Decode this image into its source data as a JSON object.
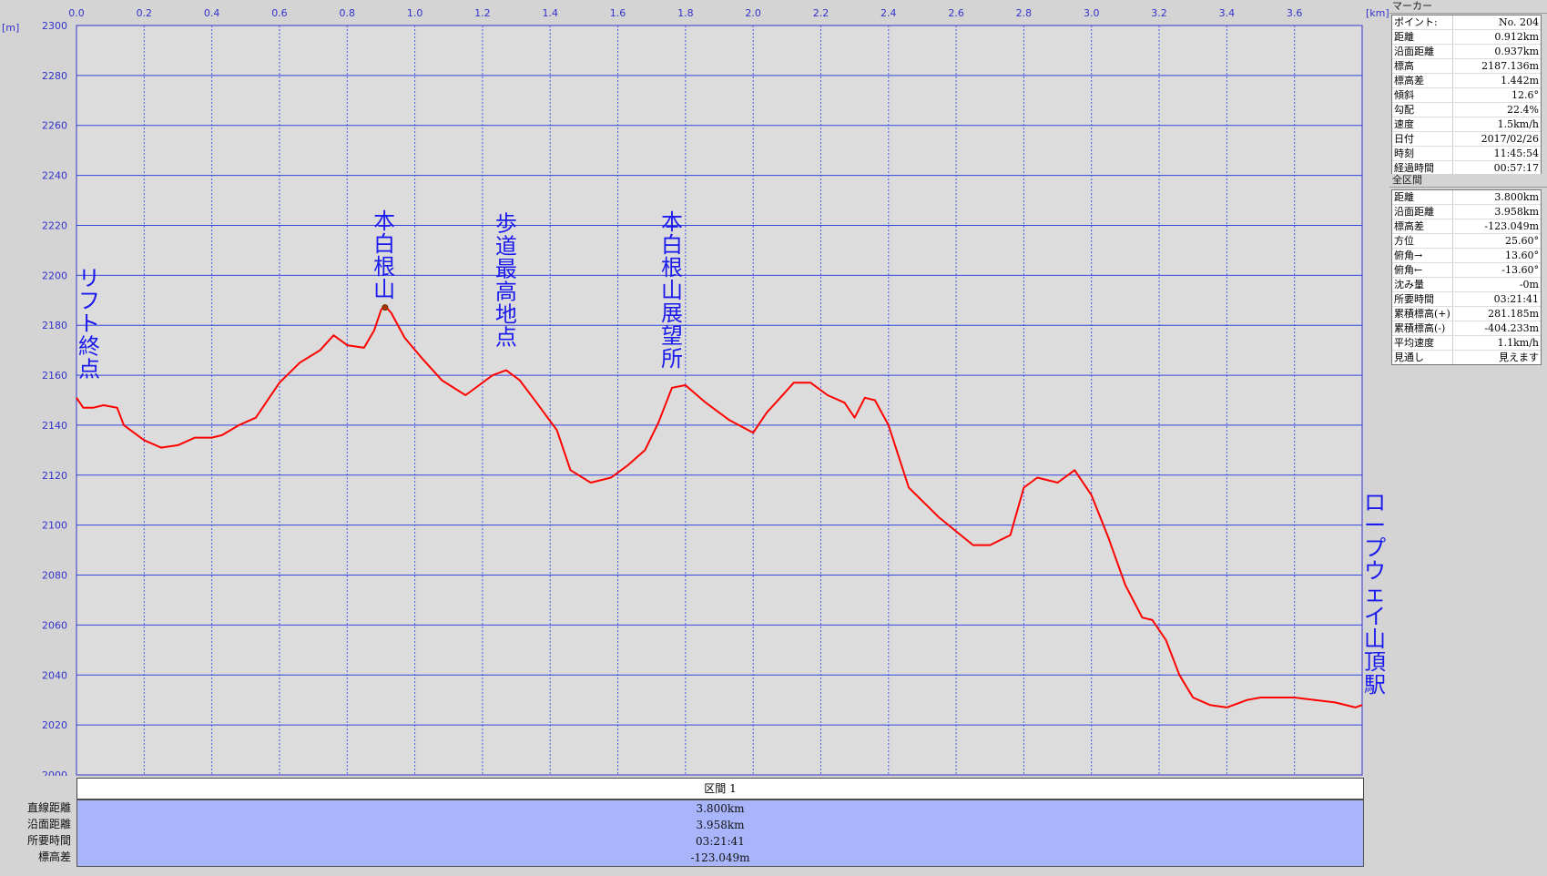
{
  "chart_data": {
    "type": "line",
    "xunit": "[km]",
    "yunit": "[m]",
    "xlim": [
      0,
      3.8
    ],
    "ylim": [
      2000,
      2300
    ],
    "xticks": [
      "0.0",
      "0.2",
      "0.4",
      "0.6",
      "0.8",
      "1.0",
      "1.2",
      "1.4",
      "1.6",
      "1.8",
      "2.0",
      "2.2",
      "2.4",
      "2.6",
      "2.8",
      "3.0",
      "3.2",
      "3.4",
      "3.6"
    ],
    "yticks": [
      "2000",
      "2020",
      "2040",
      "2060",
      "2080",
      "2100",
      "2120",
      "2140",
      "2160",
      "2180",
      "2200",
      "2220",
      "2240",
      "2260",
      "2280",
      "2300"
    ],
    "grid": true,
    "series": [
      {
        "color": "#ff0000",
        "x": [
          0.0,
          0.02,
          0.05,
          0.08,
          0.12,
          0.14,
          0.2,
          0.25,
          0.3,
          0.35,
          0.4,
          0.43,
          0.48,
          0.53,
          0.6,
          0.66,
          0.72,
          0.76,
          0.8,
          0.85,
          0.88,
          0.9,
          0.91,
          0.93,
          0.97,
          1.02,
          1.08,
          1.15,
          1.23,
          1.27,
          1.31,
          1.36,
          1.42,
          1.46,
          1.52,
          1.58,
          1.63,
          1.68,
          1.72,
          1.76,
          1.8,
          1.86,
          1.93,
          2.0,
          2.04,
          2.08,
          2.12,
          2.17,
          2.22,
          2.27,
          2.3,
          2.33,
          2.36,
          2.4,
          2.46,
          2.55,
          2.65,
          2.7,
          2.76,
          2.8,
          2.84,
          2.9,
          2.95,
          3.0,
          3.05,
          3.1,
          3.15,
          3.18,
          3.22,
          3.26,
          3.3,
          3.35,
          3.4,
          3.46,
          3.5,
          3.55,
          3.6,
          3.66,
          3.72,
          3.78,
          3.8
        ],
        "y": [
          2151,
          2147,
          2147,
          2148,
          2147,
          2140,
          2134,
          2131,
          2132,
          2135,
          2135,
          2136,
          2140,
          2143,
          2157,
          2165,
          2170,
          2176,
          2172,
          2171,
          2178,
          2186,
          2188,
          2185,
          2175,
          2167,
          2158,
          2152,
          2160,
          2162,
          2158,
          2149,
          2138,
          2122,
          2117,
          2119,
          2124,
          2130,
          2141,
          2155,
          2156,
          2149,
          2142,
          2137,
          2145,
          2151,
          2157,
          2157,
          2152,
          2149,
          2143,
          2151,
          2150,
          2140,
          2115,
          2103,
          2092,
          2092,
          2096,
          2115,
          2119,
          2117,
          2122,
          2112,
          2095,
          2076,
          2063,
          2062,
          2054,
          2040,
          2031,
          2028,
          2027,
          2030,
          2031,
          2031,
          2031,
          2030,
          2029,
          2027,
          2028
        ]
      }
    ],
    "marker": {
      "x": 0.912,
      "y": 2187.136
    },
    "annotations": [
      {
        "text": "リフト終点",
        "x": 0.0,
        "y": 2163
      },
      {
        "text": "本白根山",
        "x": 0.91,
        "y": 2205
      },
      {
        "text": "歩道最高地点",
        "x": 1.27,
        "y": 2195
      },
      {
        "text": "本白根山展望所",
        "x": 1.76,
        "y": 2191
      },
      {
        "text": "ロープウェイ山頂駅",
        "x": 3.8,
        "y": 2042
      }
    ]
  },
  "marker_panel": {
    "title": "マーカー",
    "rows": [
      {
        "k": "ポイント:",
        "v": "No. 204"
      },
      {
        "k": "距離",
        "v": "0.912km"
      },
      {
        "k": "沿面距離",
        "v": "0.937km"
      },
      {
        "k": "標高",
        "v": "2187.136m"
      },
      {
        "k": "標高差",
        "v": "1.442m"
      },
      {
        "k": "傾斜",
        "v": "12.6°"
      },
      {
        "k": "勾配",
        "v": "22.4%"
      },
      {
        "k": "速度",
        "v": "1.5km/h"
      },
      {
        "k": "日付",
        "v": "2017/02/26"
      },
      {
        "k": "時刻",
        "v": "11:45:54"
      },
      {
        "k": "経過時間",
        "v": "00:57:17"
      }
    ]
  },
  "total_panel": {
    "title": "全区間",
    "rows": [
      {
        "k": "距離",
        "v": "3.800km"
      },
      {
        "k": "沿面距離",
        "v": "3.958km"
      },
      {
        "k": "標高差",
        "v": "-123.049m"
      },
      {
        "k": "方位",
        "v": "25.60°"
      },
      {
        "k": "俯角→",
        "v": "13.60°"
      },
      {
        "k": "俯角←",
        "v": "-13.60°"
      },
      {
        "k": "沈み量",
        "v": "-0m"
      },
      {
        "k": "所要時間",
        "v": "03:21:41"
      },
      {
        "k": "累積標高(+)",
        "v": "281.185m"
      },
      {
        "k": "累積標高(-)",
        "v": "-404.233m"
      },
      {
        "k": "平均速度",
        "v": "1.1km/h"
      },
      {
        "k": "見通し",
        "v": "見えます"
      }
    ]
  },
  "section": {
    "header": "区間 1",
    "labels": [
      "直線距離",
      "沿面距離",
      "所要時間",
      "標高差"
    ],
    "values": [
      "3.800km",
      "3.958km",
      "03:21:41",
      "-123.049m"
    ]
  }
}
